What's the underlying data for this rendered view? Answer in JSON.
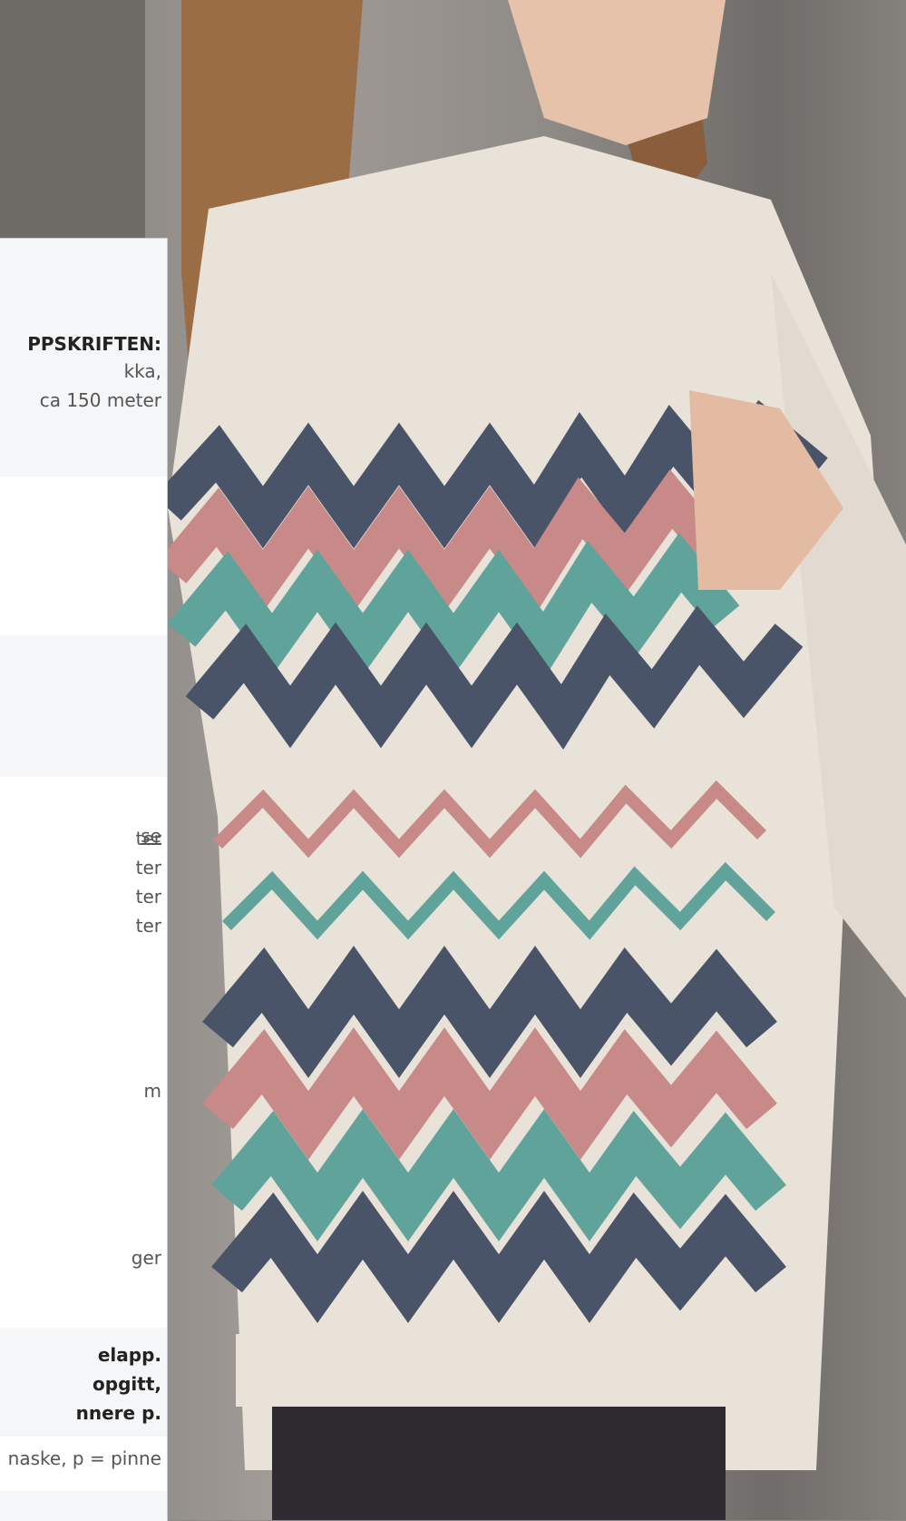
{
  "photo": {
    "subject": "model-in-zigzag-sweater",
    "colors": {
      "cream": "#e9e2d9",
      "navy": "#4a5468",
      "pink": "#c88a88",
      "teal": "#5fa39a",
      "hair": "#9b6d45",
      "bg": "#8e8a86"
    }
  },
  "panel": {
    "materials_heading": "PPSKRIFTEN:",
    "materials_line1": "kka,",
    "materials_line2": "ca 150 meter",
    "link_text": "se",
    "yarn_1": "ter",
    "yarn_2": "ter",
    "yarn_3": "ter",
    "yarn_4": "ter",
    "size_line": "m",
    "gauge_line": "ger",
    "note_line1": "elapp.",
    "note_line2": "opgitt,",
    "note_line3": "nnere p.",
    "abbrev_line": "naske, p = pinne"
  }
}
